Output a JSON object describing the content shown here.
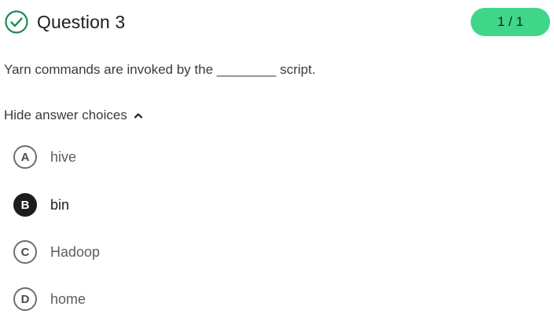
{
  "header": {
    "title": "Question 3",
    "status_icon": "check-circle-icon",
    "score": "1 / 1",
    "accent_color": "#1e8c4f",
    "badge_color": "#3fd68a"
  },
  "question": {
    "text": "Yarn commands are invoked by the ________ script."
  },
  "answers_toggle": {
    "label": "Hide answer choices",
    "icon": "chevron-up-icon"
  },
  "choices": [
    {
      "letter": "A",
      "label": "hive",
      "selected": false
    },
    {
      "letter": "B",
      "label": "bin",
      "selected": true
    },
    {
      "letter": "C",
      "label": "Hadoop",
      "selected": false
    },
    {
      "letter": "D",
      "label": "home",
      "selected": false
    }
  ]
}
